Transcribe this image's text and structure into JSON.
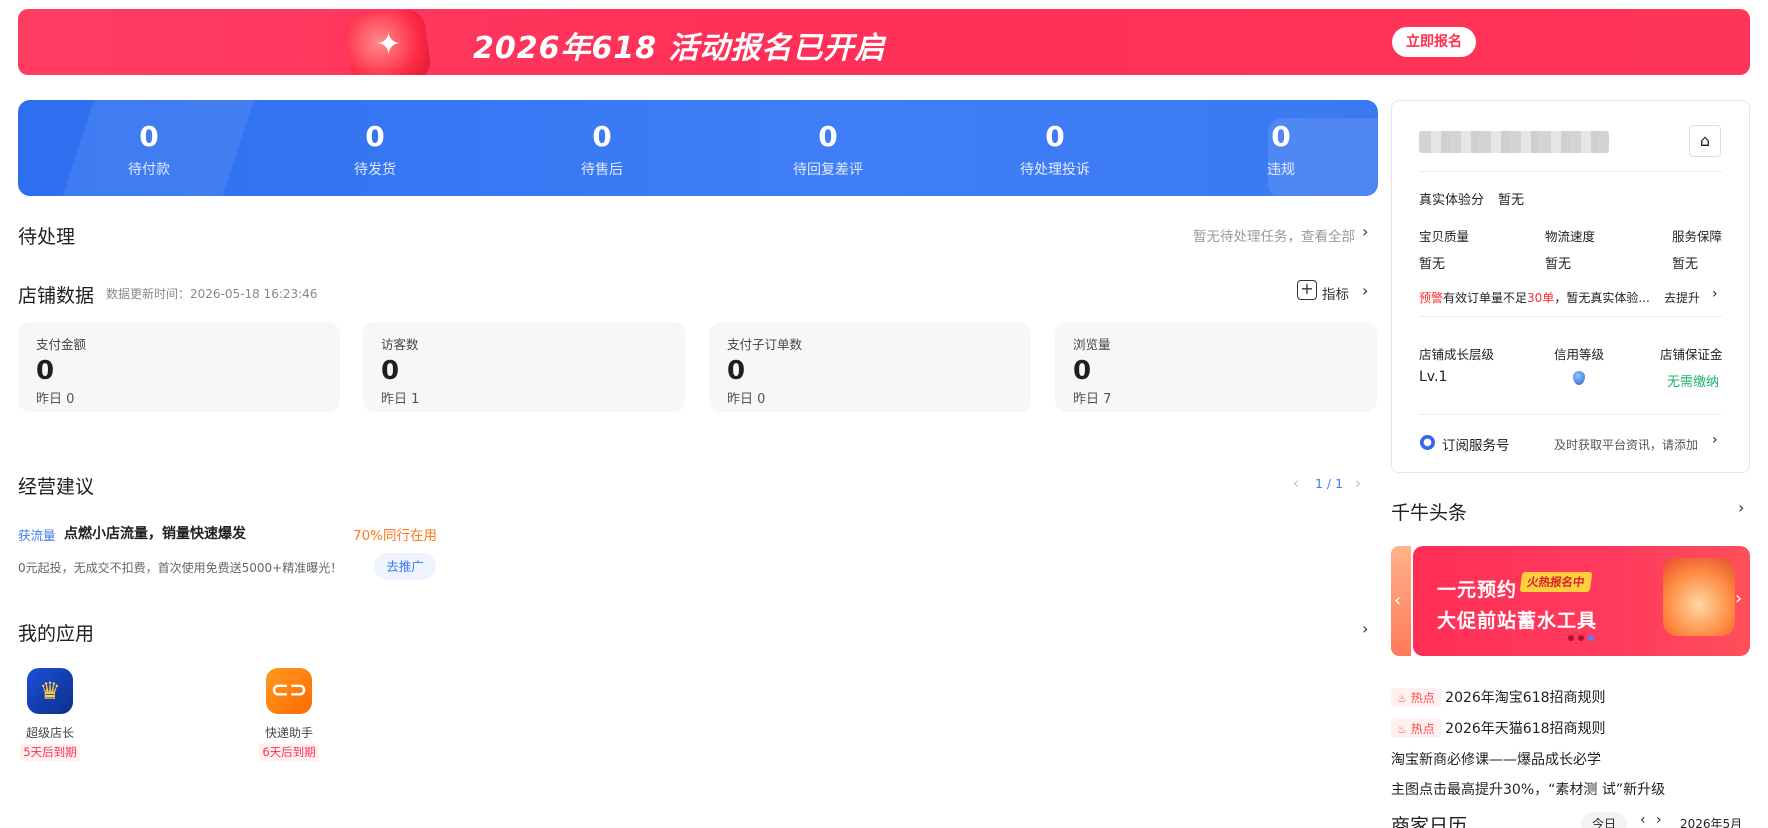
{
  "banner": {
    "title": "2026年618 活动报名已开启",
    "button": "立即报名"
  },
  "stats": [
    {
      "value": "0",
      "label": "待付款"
    },
    {
      "value": "0",
      "label": "待发货"
    },
    {
      "value": "0",
      "label": "待售后"
    },
    {
      "value": "0",
      "label": "待回复差评"
    },
    {
      "value": "0",
      "label": "待处理投诉"
    },
    {
      "value": "0",
      "label": "违规"
    }
  ],
  "pending": {
    "title": "待处理",
    "link": "暂无待处理任务，查看全部"
  },
  "store_data": {
    "title": "店铺数据",
    "updated": "数据更新时间：2026-05-18 16:23:46",
    "metrics_label": "指标",
    "cards": [
      {
        "label": "支付金额",
        "value": "0",
        "yesterday": "昨日 0"
      },
      {
        "label": "访客数",
        "value": "0",
        "yesterday": "昨日 1"
      },
      {
        "label": "支付子订单数",
        "value": "0",
        "yesterday": "昨日 0"
      },
      {
        "label": "浏览量",
        "value": "0",
        "yesterday": "昨日 7"
      }
    ]
  },
  "advice": {
    "title": "经营建议",
    "pager": "1 / 1",
    "tag": "获流量",
    "headline": "点燃小店流量，销量快速爆发",
    "peer": "70%同行在用",
    "desc": "0元起投，无成交不扣费，首次使用免费送5000+精准曝光！",
    "button": "去推广"
  },
  "apps": {
    "title": "我的应用",
    "items": [
      {
        "name": "超级店长",
        "expire": "5天后到期",
        "icon": "crown-icon"
      },
      {
        "name": "快递助手",
        "expire": "6天后到期",
        "icon": "link-icon"
      }
    ]
  },
  "account": {
    "experience_label": "真实体验分",
    "experience_value": "暂无",
    "scores": [
      {
        "label": "宝贝质量",
        "value": "暂无"
      },
      {
        "label": "物流速度",
        "value": "暂无"
      },
      {
        "label": "服务保障",
        "value": "暂无"
      }
    ],
    "warning_tag": "预警",
    "warning_pre": "有效订单量不足",
    "warning_num": "30单",
    "warning_post": "，暂无真实体验...",
    "warning_link": "去提升",
    "levels": [
      {
        "label": "店铺成长层级",
        "value": "Lv.1"
      },
      {
        "label": "信用等级",
        "value": ""
      },
      {
        "label": "店铺保证金",
        "value": "无需缴纳"
      }
    ],
    "subscribe_label": "订阅服务号",
    "subscribe_desc": "及时获取平台资讯，请添加"
  },
  "headlines": {
    "title": "千牛头条",
    "promo_line1": "一元预约",
    "promo_badge": "火热报名中",
    "promo_line2": "大促前站蓄水工具",
    "news": [
      {
        "hot": "热点",
        "text": "2026年淘宝618招商规则"
      },
      {
        "hot": "热点",
        "text": "2026年天猫618招商规则"
      },
      {
        "hot": "",
        "text": "淘宝新商必修课——爆品成长必学"
      },
      {
        "hot": "",
        "text": "主图点击最高提升30%，“素材测 试”新升级"
      }
    ]
  },
  "calendar": {
    "title": "商家日历",
    "today": "今日",
    "month": "2026年5月"
  },
  "colors": {
    "primary_blue": "#3b79f3",
    "banner_red": "#ff2f57",
    "warn_red": "#ff2d2d",
    "green": "#21b26b",
    "orange": "#ff7a1a"
  }
}
